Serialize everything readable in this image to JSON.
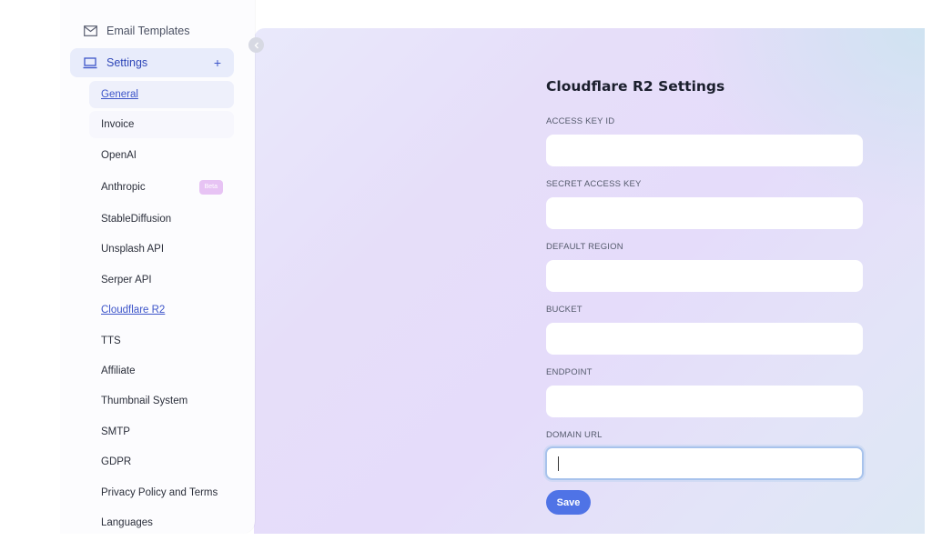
{
  "sidebar": {
    "top_item": {
      "label": "Email Templates",
      "icon": "mail-icon"
    },
    "settings": {
      "label": "Settings",
      "icon": "laptop-icon",
      "expand": "+"
    },
    "sub_items": [
      {
        "label": "General"
      },
      {
        "label": "Invoice"
      },
      {
        "label": "OpenAI"
      },
      {
        "label": "Anthropic",
        "badge": "Beta"
      },
      {
        "label": "StableDiffusion"
      },
      {
        "label": "Unsplash API"
      },
      {
        "label": "Serper API"
      },
      {
        "label": "Cloudflare R2"
      },
      {
        "label": "TTS"
      },
      {
        "label": "Affiliate"
      },
      {
        "label": "Thumbnail System"
      },
      {
        "label": "SMTP"
      },
      {
        "label": "GDPR"
      },
      {
        "label": "Privacy Policy and Terms"
      },
      {
        "label": "Languages"
      }
    ]
  },
  "panel": {
    "title": "Cloudflare R2 Settings",
    "fields": [
      {
        "label": "ACCESS KEY ID",
        "value": ""
      },
      {
        "label": "SECRET ACCESS KEY",
        "value": ""
      },
      {
        "label": "DEFAULT REGION",
        "value": ""
      },
      {
        "label": "BUCKET",
        "value": ""
      },
      {
        "label": "ENDPOINT",
        "value": ""
      },
      {
        "label": "DOMAIN URL",
        "value": ""
      }
    ],
    "save_label": "Save"
  },
  "colors": {
    "accent": "#4f73e6",
    "link": "#3d55c9",
    "badge": "#e7c3f4"
  }
}
